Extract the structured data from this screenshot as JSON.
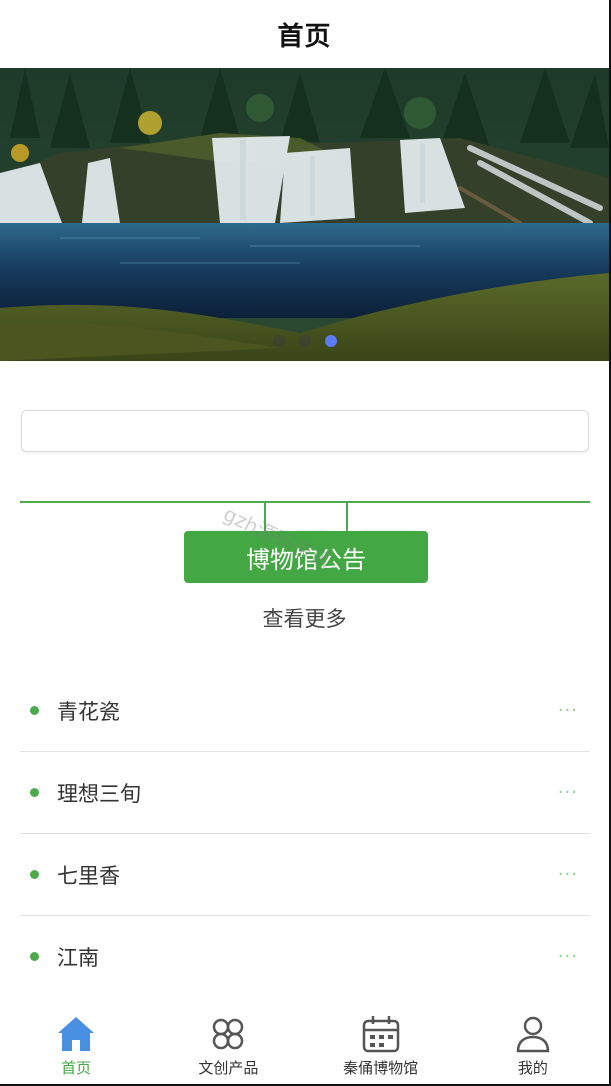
{
  "header": {
    "title": "首页"
  },
  "banner": {
    "slides": 3,
    "active_index": 2,
    "colors": {
      "dot": "#5a5a5a",
      "dot_active": "#5b7cf5"
    }
  },
  "search": {
    "placeholder": ""
  },
  "notice": {
    "button_label": "博物馆公告",
    "more_label": "查看更多",
    "watermark": "gzh源码资讯"
  },
  "list": {
    "items": [
      {
        "title": "青花瓷",
        "more": "···"
      },
      {
        "title": "理想三旬",
        "more": "···"
      },
      {
        "title": "七里香",
        "more": "···"
      },
      {
        "title": "江南",
        "more": "···"
      }
    ]
  },
  "tabbar": {
    "items": [
      {
        "label": "首页",
        "icon": "home-icon",
        "active": true
      },
      {
        "label": "文创产品",
        "icon": "clover-icon",
        "active": false
      },
      {
        "label": "秦俑博物馆",
        "icon": "calendar-icon",
        "active": false
      },
      {
        "label": "我的",
        "icon": "user-icon",
        "active": false
      }
    ]
  },
  "colors": {
    "accent_green": "#43a843",
    "home_icon_blue": "#4a90e2",
    "tab_icon_gray": "#555555"
  }
}
